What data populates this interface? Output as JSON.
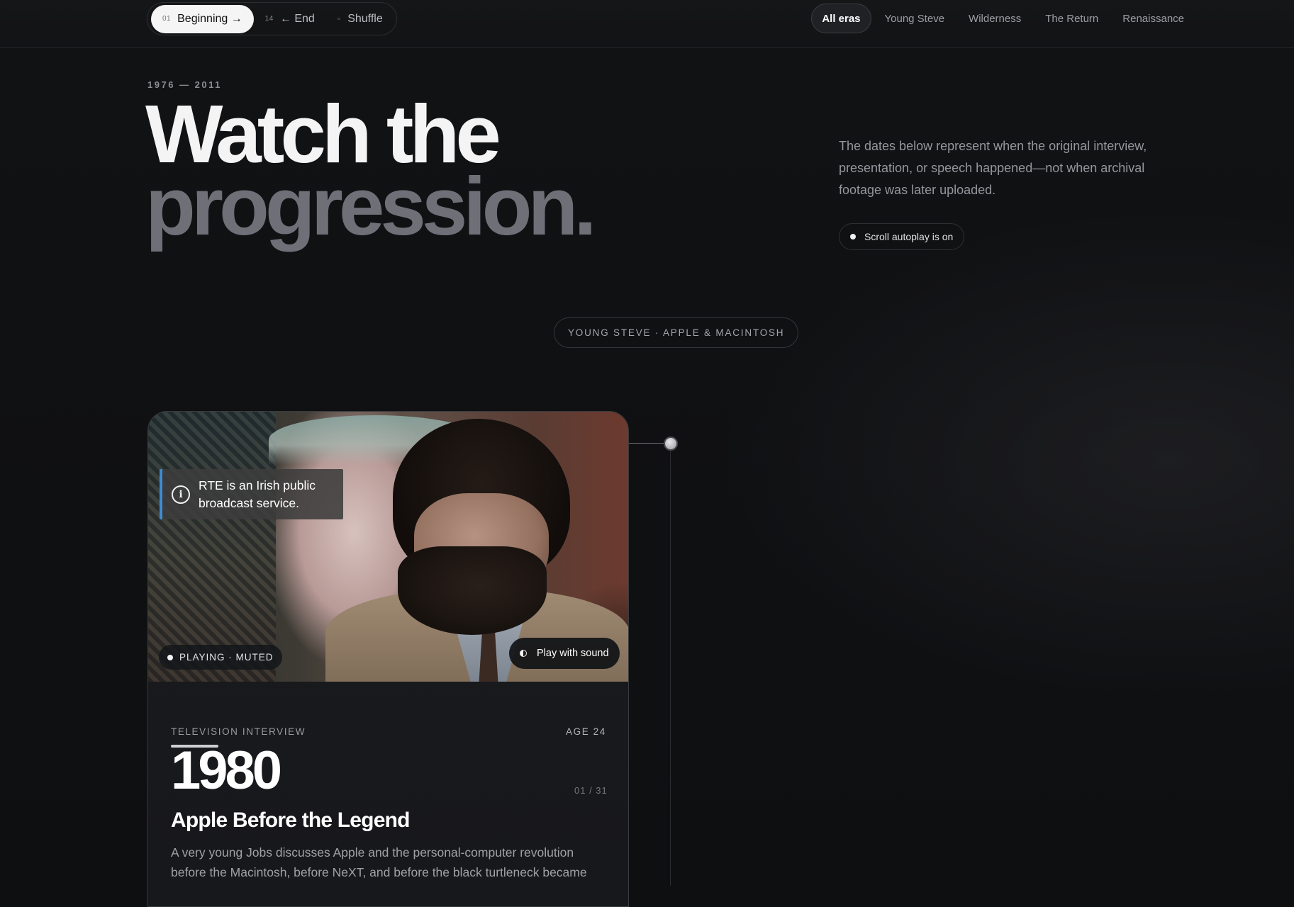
{
  "topbar": {
    "sequence": [
      {
        "num": "01",
        "label": "Beginning →",
        "active": true
      },
      {
        "num": "14",
        "label": "← End",
        "active": false
      },
      {
        "num": "≈",
        "label": "Shuffle",
        "active": false
      }
    ],
    "eras": [
      {
        "label": "All eras",
        "active": true
      },
      {
        "label": "Young Steve",
        "active": false
      },
      {
        "label": "Wilderness",
        "active": false
      },
      {
        "label": "The Return",
        "active": false
      },
      {
        "label": "Renaissance",
        "active": false
      }
    ]
  },
  "hero": {
    "dates": "1976 — 2011",
    "headline_line1": "Watch the",
    "headline_line2": "progression.",
    "note": "The dates below represent when the original interview, presentation, or speech happened—not when archival footage was later uploaded.",
    "autoplay_label": "Scroll autoplay is on"
  },
  "era_chip": "YOUNG STEVE · APPLE & MACINTOSH",
  "card": {
    "caption": "RTE is an Irish public broadcast service.",
    "status": "PLAYING · MUTED",
    "sound_button": "Play with sound",
    "kind": "TELEVISION INTERVIEW",
    "age": "AGE 24",
    "year": "1980",
    "counter": "01 / 31",
    "title": "Apple Before the Legend",
    "description": "A very young Jobs discusses Apple and the personal-computer revolution before the Macintosh, before NeXT, and before the black turtleneck became"
  }
}
